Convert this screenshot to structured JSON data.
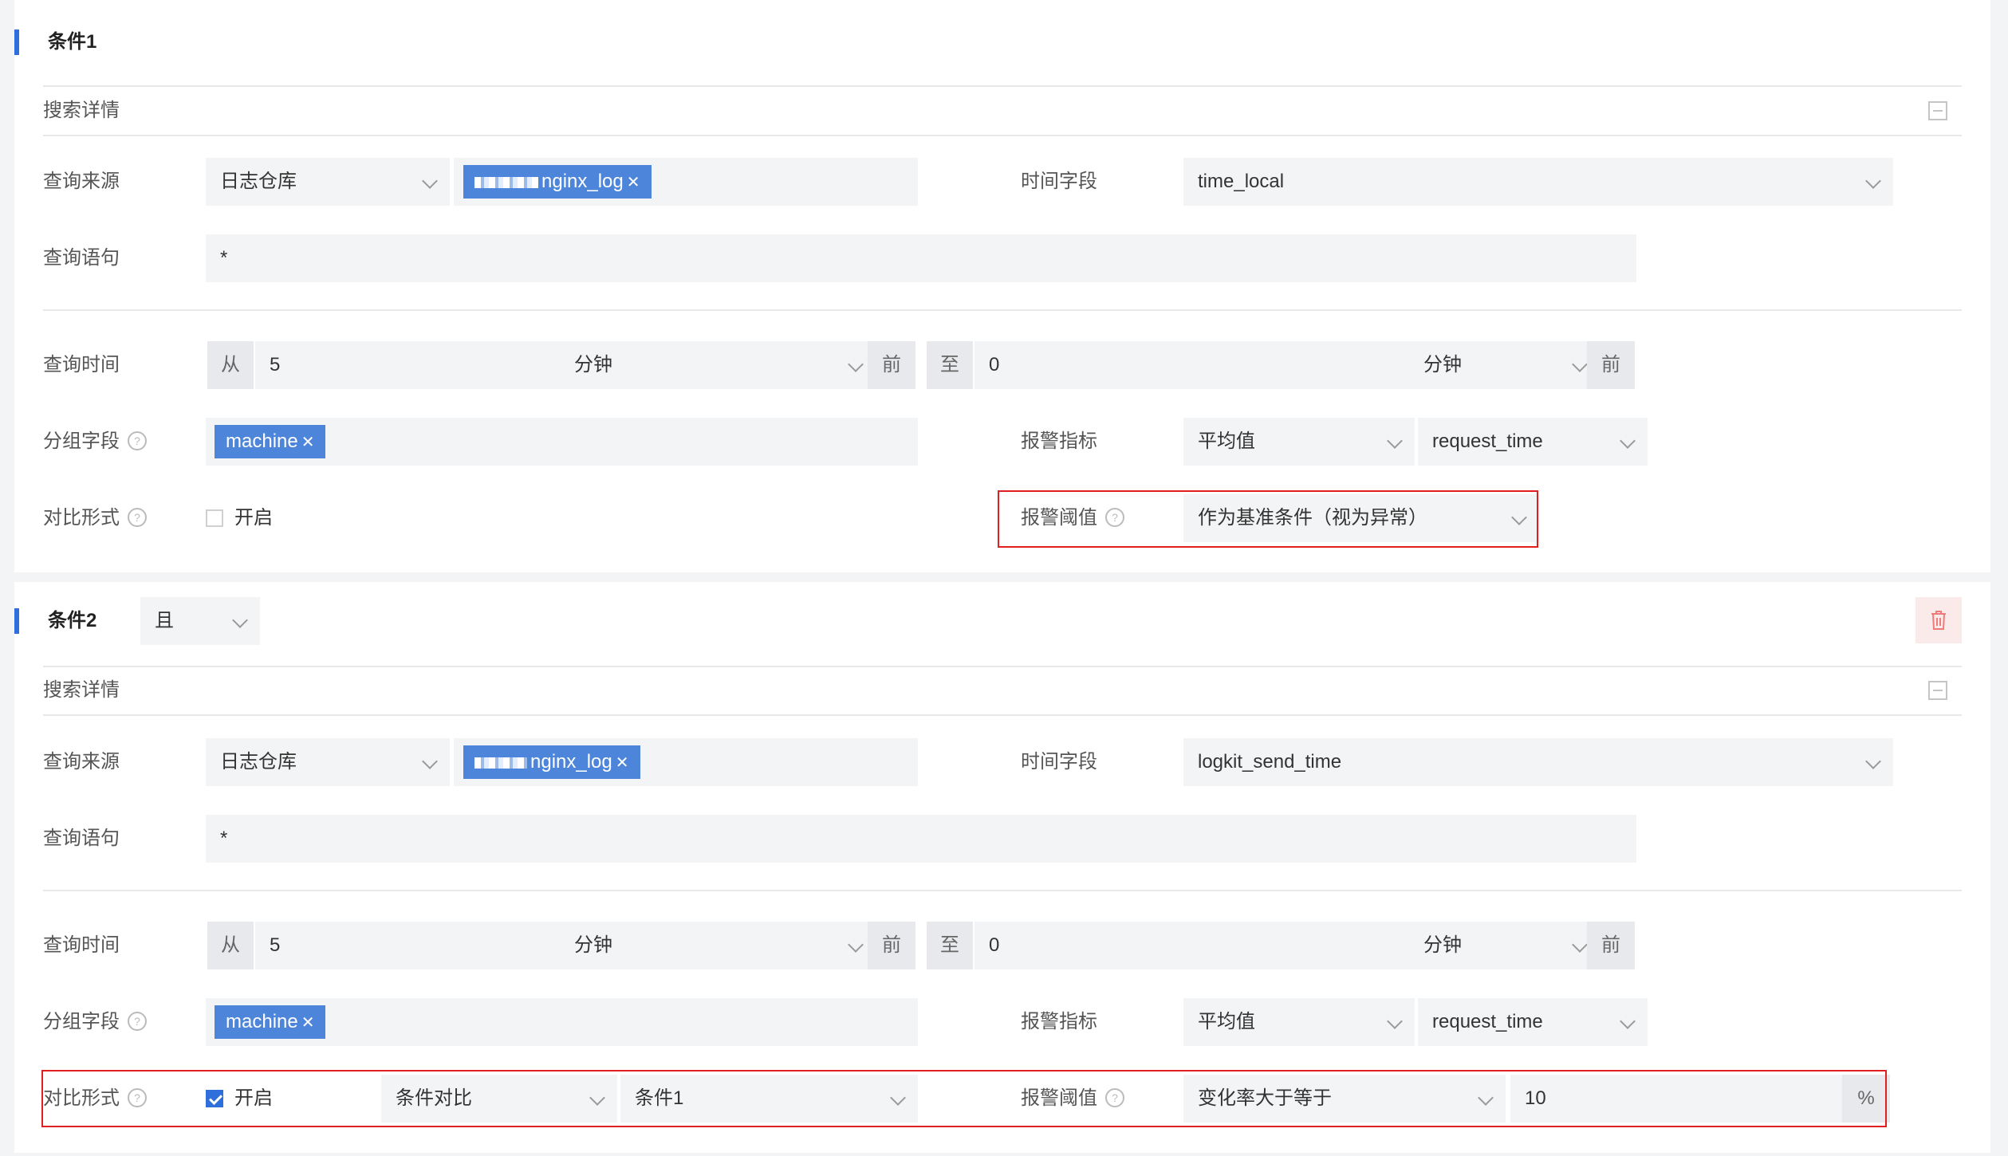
{
  "conditions": [
    {
      "title": "条件1",
      "section_label": "搜索详情",
      "source": {
        "label": "查询来源",
        "type": "日志仓库",
        "repo_tag": "nginx_log"
      },
      "time_field": {
        "label": "时间字段",
        "value": "time_local"
      },
      "query": {
        "label": "查询语句",
        "value": "*"
      },
      "query_time": {
        "label": "查询时间",
        "from_prefix": "从",
        "from_value": "5",
        "from_unit": "分钟",
        "from_suffix": "前",
        "to_prefix": "至",
        "to_value": "0",
        "to_unit": "分钟",
        "to_suffix": "前"
      },
      "group_field": {
        "label": "分组字段",
        "help": "?",
        "tag": "machine"
      },
      "alert_metric": {
        "label": "报警指标",
        "agg": "平均值",
        "field": "request_time"
      },
      "compare": {
        "label": "对比形式",
        "help": "?",
        "enabled": false,
        "enable_label": "开启"
      },
      "threshold": {
        "label": "报警阈值",
        "help": "?",
        "value": "作为基准条件（视为异常）"
      }
    },
    {
      "title": "条件2",
      "logic": "且",
      "section_label": "搜索详情",
      "source": {
        "label": "查询来源",
        "type": "日志仓库",
        "repo_tag": "nginx_log"
      },
      "time_field": {
        "label": "时间字段",
        "value": "logkit_send_time"
      },
      "query": {
        "label": "查询语句",
        "value": "*"
      },
      "query_time": {
        "label": "查询时间",
        "from_prefix": "从",
        "from_value": "5",
        "from_unit": "分钟",
        "from_suffix": "前",
        "to_prefix": "至",
        "to_value": "0",
        "to_unit": "分钟",
        "to_suffix": "前"
      },
      "group_field": {
        "label": "分组字段",
        "help": "?",
        "tag": "machine"
      },
      "alert_metric": {
        "label": "报警指标",
        "agg": "平均值",
        "field": "request_time"
      },
      "compare": {
        "label": "对比形式",
        "help": "?",
        "enabled": true,
        "enable_label": "开启",
        "mode": "条件对比",
        "target": "条件1"
      },
      "threshold": {
        "label": "报警阈值",
        "help": "?",
        "op": "变化率大于等于",
        "value": "10",
        "unit": "%"
      }
    }
  ],
  "colors": {
    "accent": "#2f6fdc",
    "tag": "#4d85da",
    "highlight": "#e02020"
  },
  "icons": {
    "collapse": "collapse-icon",
    "delete": "trash-icon",
    "dropdown": "chevron-down-icon",
    "help": "help-circle-icon"
  }
}
